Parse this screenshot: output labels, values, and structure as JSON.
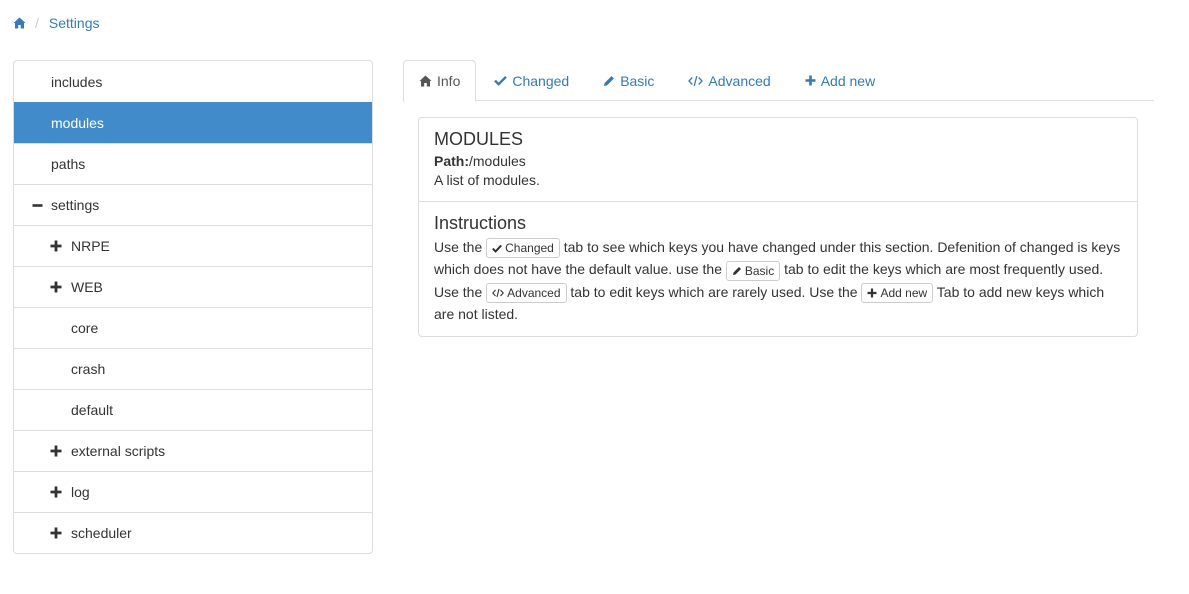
{
  "breadcrumb": {
    "home_icon": "home-icon",
    "current": "Settings"
  },
  "tree": {
    "items": [
      {
        "label": "includes",
        "level": 0,
        "toggle": "",
        "active": false
      },
      {
        "label": "modules",
        "level": 0,
        "toggle": "",
        "active": true
      },
      {
        "label": "paths",
        "level": 0,
        "toggle": "",
        "active": false
      },
      {
        "label": "settings",
        "level": 0,
        "toggle": "minus",
        "active": false
      },
      {
        "label": "NRPE",
        "level": 1,
        "toggle": "plus",
        "active": false
      },
      {
        "label": "WEB",
        "level": 1,
        "toggle": "plus",
        "active": false
      },
      {
        "label": "core",
        "level": 1,
        "toggle": "",
        "active": false
      },
      {
        "label": "crash",
        "level": 1,
        "toggle": "",
        "active": false
      },
      {
        "label": "default",
        "level": 1,
        "toggle": "",
        "active": false
      },
      {
        "label": "external scripts",
        "level": 1,
        "toggle": "plus",
        "active": false
      },
      {
        "label": "log",
        "level": 1,
        "toggle": "plus",
        "active": false
      },
      {
        "label": "scheduler",
        "level": 1,
        "toggle": "plus",
        "active": false
      }
    ]
  },
  "tabs": [
    {
      "label": "Info",
      "icon": "home-icon",
      "active": true
    },
    {
      "label": "Changed",
      "icon": "check-icon",
      "active": false
    },
    {
      "label": "Basic",
      "icon": "pencil-icon",
      "active": false
    },
    {
      "label": "Advanced",
      "icon": "code-icon",
      "active": false
    },
    {
      "label": "Add new",
      "icon": "plus-icon",
      "active": false
    }
  ],
  "info": {
    "title": "MODULES",
    "path_label": "Path:",
    "path_value": "/modules",
    "description": "A list of modules."
  },
  "instructions": {
    "title": "Instructions",
    "t1": "Use the ",
    "chip_changed": "Changed",
    "t2": " tab to see which keys you have changed under this section. Defenition of changed is keys which does not have the default value. use the ",
    "chip_basic": "Basic",
    "t3": " tab to edit the keys which are most frequently used. Use the ",
    "chip_advanced": "Advanced",
    "t4": " tab to edit keys which are rarely used. Use the ",
    "chip_addnew": "Add new",
    "t5": " Tab to add new keys which are not listed."
  },
  "colors": {
    "link": "#337ab7",
    "active_bg": "#428bca",
    "border": "#dddddd"
  }
}
